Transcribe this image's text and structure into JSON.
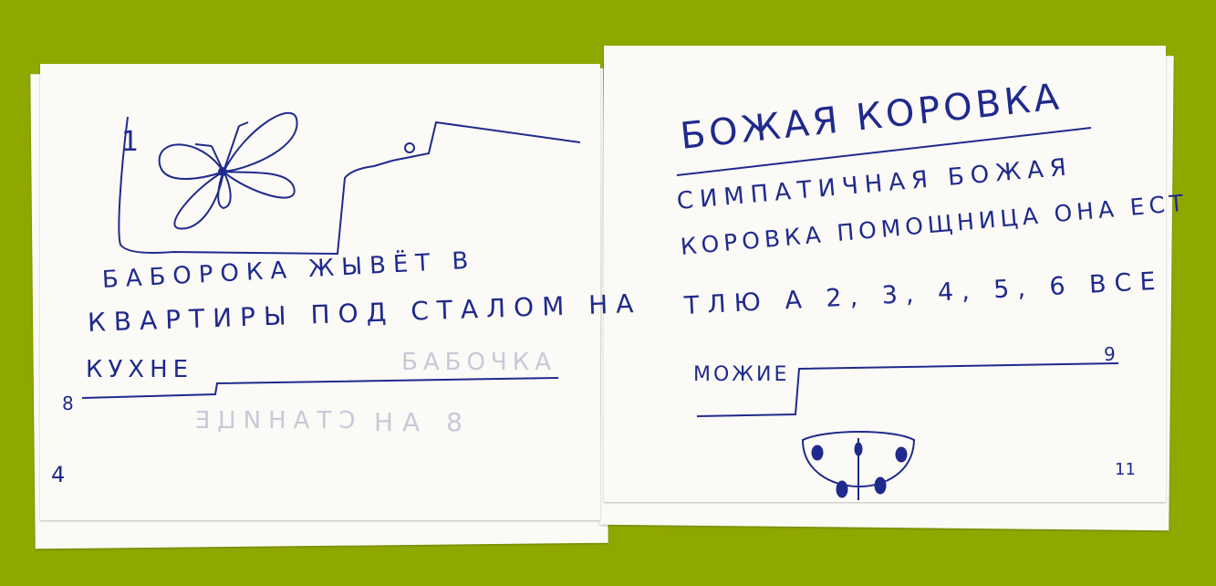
{
  "left_page": {
    "page_number_top": "8",
    "page_number_bottom": "4",
    "lines": [
      "БАБОРОКА ЖЫВЁТ В",
      "КВАРТИРЫ ПОД СТАЛОМ НА",
      "КУХНЕ"
    ],
    "show_through_text": [
      "БАБОЧКА",
      "НА 8",
      "СТАНИЦЕ"
    ]
  },
  "right_page": {
    "title": "БОЖАЯ КОРОВКА",
    "page_number_top": "9",
    "page_number_bottom": "11",
    "lines": [
      "СИМПАТИЧНАЯ БОЖАЯ",
      "КОРОВКА ПОМОЩНИЦА ОНА ЕСТ",
      "ТЛЮ А 2, 3, 4, 5, 6 ВСЕ",
      "МОЖИЕ"
    ]
  },
  "colors": {
    "background": "#8fa800",
    "paper": "#fbfaf6",
    "ink": "#1f2a8c"
  }
}
